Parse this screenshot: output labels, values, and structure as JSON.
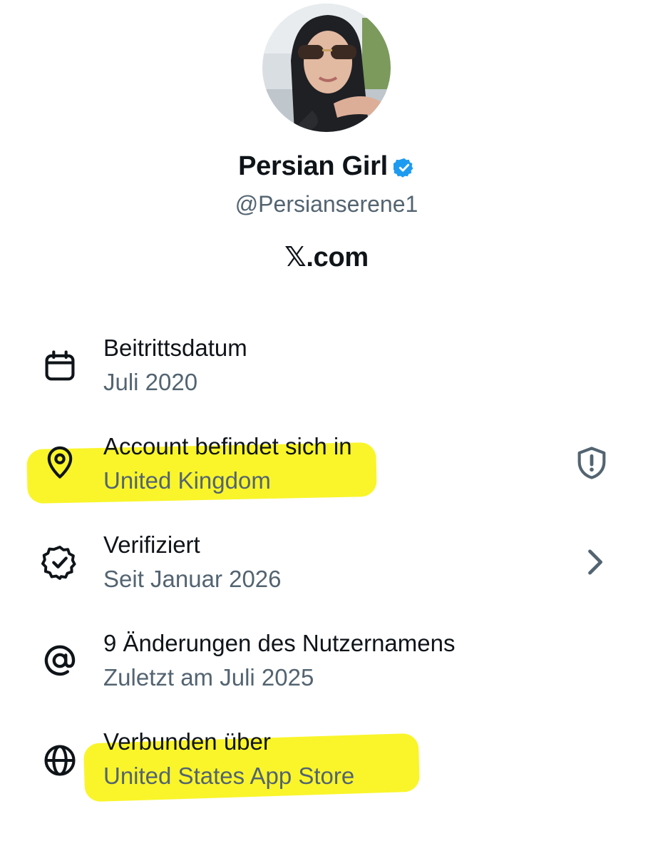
{
  "profile": {
    "name": "Persian Girl",
    "handle": "@Persianserene1",
    "brand": "𝕏.com",
    "verified_badge_icon": "verified-badge-icon",
    "badge_color": "#1d9bf0"
  },
  "about": {
    "items": [
      {
        "icon": "calendar-icon",
        "title": "Beitrittsdatum",
        "subtitle": "Juli 2020"
      },
      {
        "icon": "location-pin-icon",
        "title": "Account befindet sich in",
        "subtitle": "United Kingdom",
        "trailing_icon": "shield-alert-icon",
        "highlighted": true
      },
      {
        "icon": "verified-check-icon",
        "title": "Verifiziert",
        "subtitle": "Seit Januar 2026",
        "trailing_icon": "chevron-right-icon"
      },
      {
        "icon": "at-sign-icon",
        "title": "9 Änderungen des Nutzernamens",
        "subtitle": "Zuletzt am Juli 2025"
      },
      {
        "icon": "globe-icon",
        "title": "Verbunden über",
        "subtitle": "United States App Store",
        "highlighted": true
      }
    ]
  },
  "colors": {
    "text_primary": "#0f1419",
    "text_secondary": "#536471",
    "highlight": "#f9f52a"
  }
}
